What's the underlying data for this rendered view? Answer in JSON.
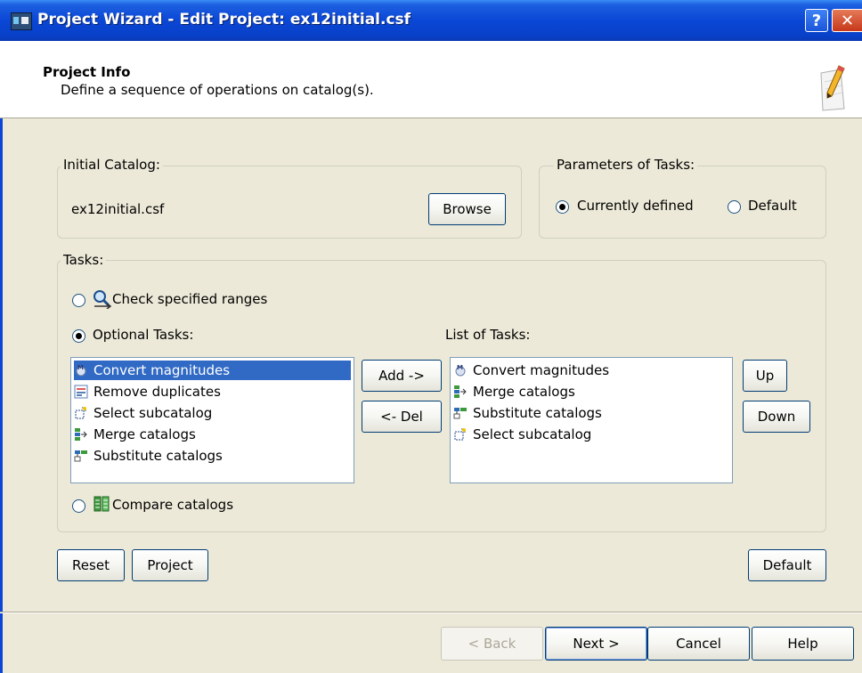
{
  "window": {
    "title": "Project Wizard - Edit Project: ex12initial.csf",
    "help_glyph": "?",
    "close_glyph": "✕"
  },
  "header": {
    "title": "Project Info",
    "subtitle": "Define a sequence of operations on catalog(s)."
  },
  "initial_catalog": {
    "legend": "Initial Catalog:",
    "value": "ex12initial.csf",
    "browse_label": "Browse"
  },
  "parameters": {
    "legend": "Parameters of Tasks:",
    "options": [
      {
        "label": "Currently defined",
        "selected": true
      },
      {
        "label": "Default",
        "selected": false
      }
    ]
  },
  "tasks": {
    "legend": "Tasks:",
    "check_ranges_label": "Check specified ranges",
    "optional_label": "Optional Tasks:",
    "list_of_tasks_label": "List of Tasks:",
    "compare_label": "Compare catalogs",
    "optional_items": [
      {
        "label": "Convert magnitudes",
        "icon": "convert-magnitudes-icon",
        "selected": true
      },
      {
        "label": "Remove duplicates",
        "icon": "remove-duplicates-icon",
        "selected": false
      },
      {
        "label": "Select subcatalog",
        "icon": "select-subcatalog-icon",
        "selected": false
      },
      {
        "label": "Merge catalogs",
        "icon": "merge-catalogs-icon",
        "selected": false
      },
      {
        "label": "Substitute catalogs",
        "icon": "substitute-catalogs-icon",
        "selected": false
      }
    ],
    "list_items": [
      {
        "label": "Convert magnitudes",
        "icon": "convert-magnitudes-icon"
      },
      {
        "label": "Merge catalogs",
        "icon": "merge-catalogs-icon"
      },
      {
        "label": "Substitute catalogs",
        "icon": "substitute-catalogs-icon"
      },
      {
        "label": "Select subcatalog",
        "icon": "select-subcatalog-icon"
      }
    ],
    "add_label": "Add ->",
    "del_label": "<- Del",
    "up_label": "Up",
    "down_label": "Down"
  },
  "bottom_buttons": {
    "reset_label": "Reset",
    "project_label": "Project",
    "default_label": "Default"
  },
  "footer": {
    "back_label": "< Back",
    "next_label": "Next >",
    "cancel_label": "Cancel",
    "help_label": "Help"
  }
}
